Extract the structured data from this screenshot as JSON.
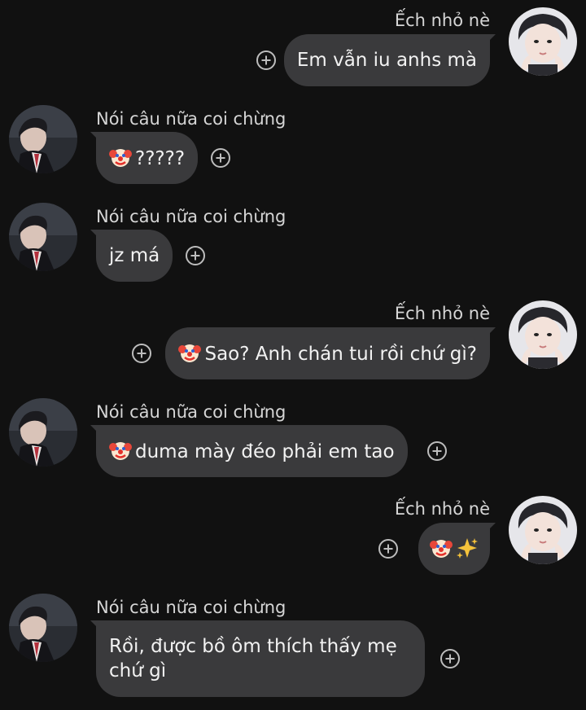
{
  "conversation": {
    "messages": [
      {
        "sender": "Ếch nhỏ nè",
        "side": "right",
        "text": "Em vẫn iu anhs mà",
        "emoji": []
      },
      {
        "sender": "Nói câu nữa coi chừng",
        "side": "left",
        "text": "?????",
        "emoji": [
          "clown"
        ]
      },
      {
        "sender": "Nói câu nữa coi chừng",
        "side": "left",
        "text": "jz má",
        "emoji": []
      },
      {
        "sender": "Ếch nhỏ nè",
        "side": "right",
        "text": "Sao? Anh chán tui rồi chứ gì?",
        "emoji": [
          "clown"
        ]
      },
      {
        "sender": "Nói câu nữa coi chừng",
        "side": "left",
        "text": "duma mày đéo phải em tao",
        "emoji": [
          "clown"
        ]
      },
      {
        "sender": "Ếch nhỏ nè",
        "side": "right",
        "text": "",
        "emoji": [
          "clown",
          "sparkles"
        ]
      },
      {
        "sender": "Nói câu nữa coi chừng",
        "side": "left",
        "text": "Rồi, được bồ ôm thích thấy mẹ chứ gì",
        "emoji": []
      }
    ]
  },
  "icons": {
    "react_button": "add-reaction-icon",
    "clown": "clown-face-emoji",
    "sparkles": "sparkles-emoji"
  },
  "colors": {
    "background": "#111111",
    "bubble": "#3a3a3c",
    "text": "#f2f2f2",
    "name": "#d6d6d6",
    "icon": "#bdbdbd"
  }
}
